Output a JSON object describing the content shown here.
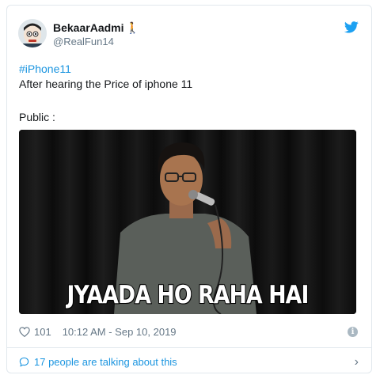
{
  "author": {
    "display_name": "BekaarAadmi",
    "name_emoji": "🚶",
    "handle": "@RealFun14",
    "avatar_icon": "avatar-face-icon"
  },
  "tweet": {
    "hashtag": "#iPhone11",
    "line1": "After hearing the Price of iphone 11",
    "line2": "Public :"
  },
  "media": {
    "caption": "JYAADA HO RAHA HAI"
  },
  "footer": {
    "likes": "101",
    "timestamp": "10:12 AM - Sep 10, 2019",
    "info_icon": "i",
    "talking": "17 people are talking about this",
    "chevron": "›"
  },
  "colors": {
    "link_blue": "#1b95e0",
    "twitter_blue": "#1da1f2",
    "muted": "#657786",
    "text": "#14171a",
    "border": "#e1e8ed"
  }
}
